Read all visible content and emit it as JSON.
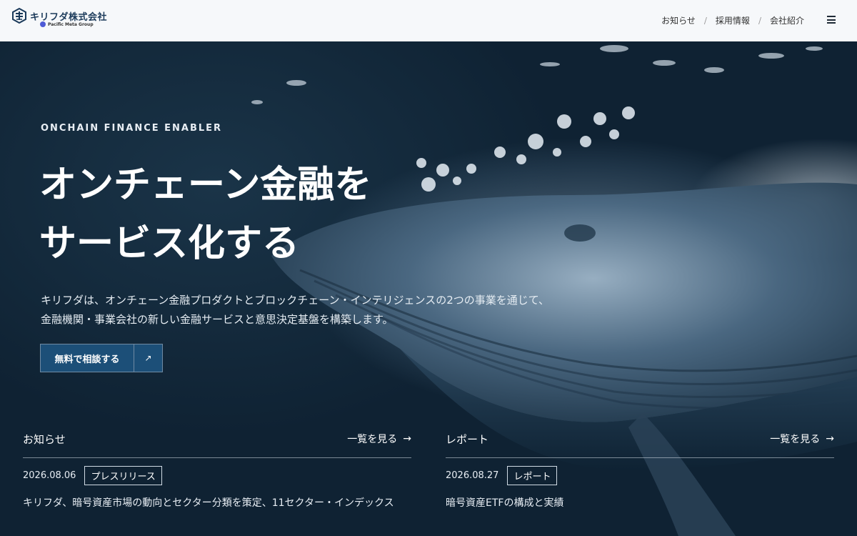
{
  "header": {
    "logo_text": "キリフダ株式会社",
    "logo_sub": "Pacific Meta Group",
    "nav": [
      {
        "label": "お知らせ"
      },
      {
        "label": "採用情報"
      },
      {
        "label": "会社紹介"
      }
    ],
    "nav_separator": "/"
  },
  "hero": {
    "eyebrow": "ONCHAIN FINANCE ENABLER",
    "title_line1": "オンチェーン金融を",
    "title_line2": "サービス化する",
    "desc_line1": "キリフダは、オンチェーン金融プロダクトとブロックチェーン・インテリジェンスの2つの事業を通じて、",
    "desc_line2": "金融機関・事業会社の新しい金融サービスと意思決定基盤を構築します。",
    "cta_label": "無料で相談する",
    "cta_arrow": "↗"
  },
  "news": {
    "title": "お知らせ",
    "more": "一覧を見る",
    "arrow": "→",
    "date": "2026.08.06",
    "tag": "プレスリリース",
    "headline_partial": "キリフダ、暗号資産市場の動向とセクター分類を策定、11セクター・インデックス"
  },
  "reports": {
    "title": "レポート",
    "more": "一覧を見る",
    "arrow": "→",
    "date": "2026.08.27",
    "tag": "レポート",
    "headline_partial": "暗号資産ETFの構成と実績"
  },
  "colors": {
    "header_bg": "#f6f8fa",
    "brand": "#1b3a5a",
    "cta_bg": "#1c4f78"
  }
}
